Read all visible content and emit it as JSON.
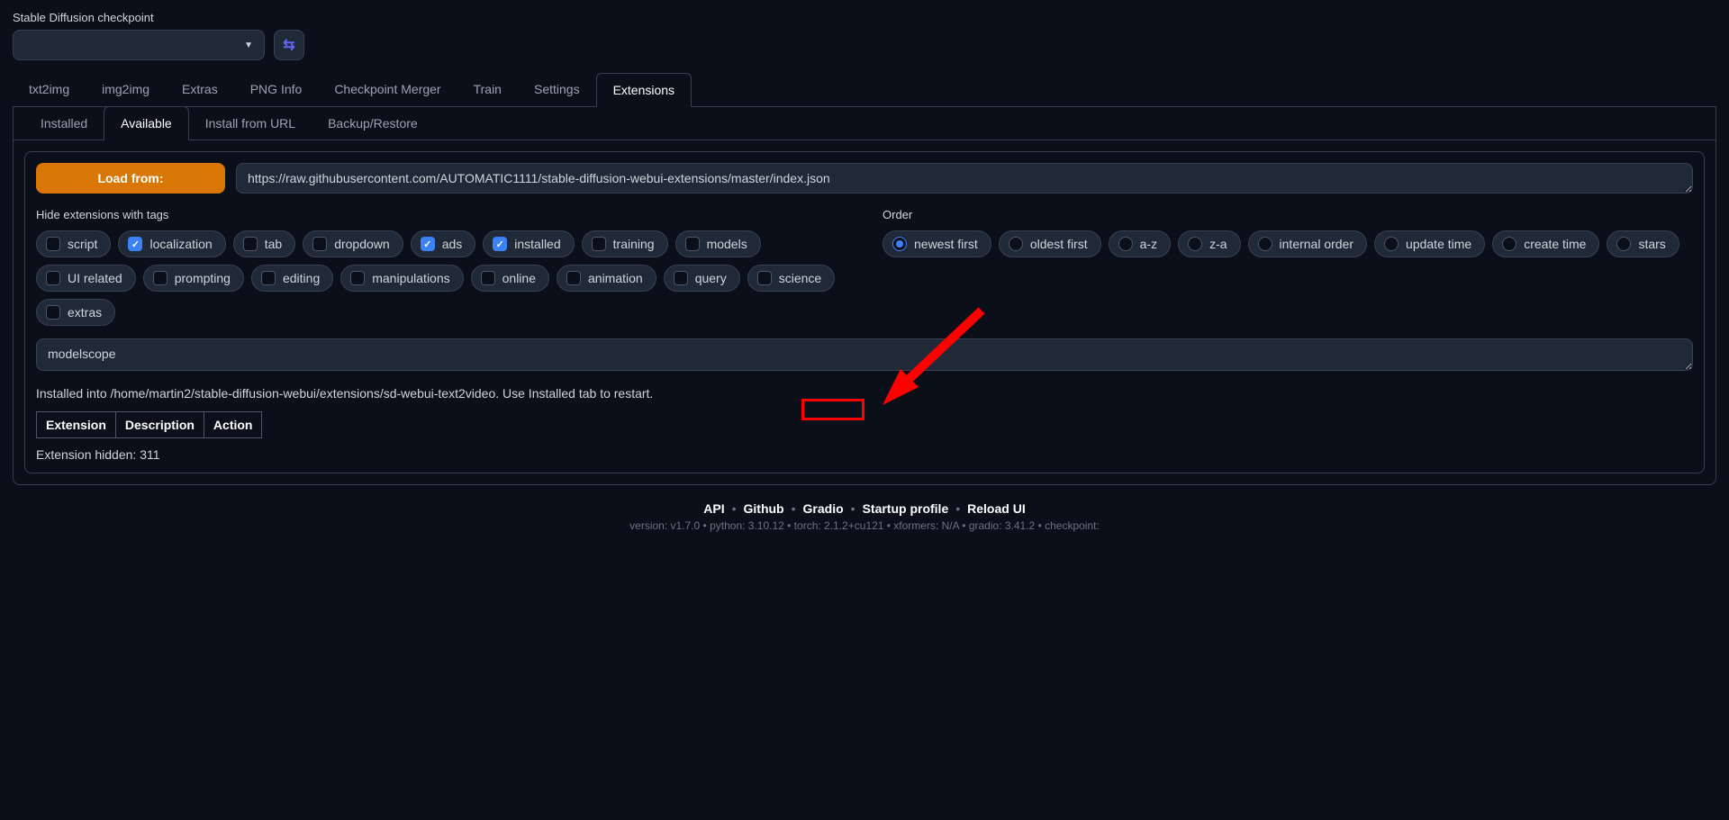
{
  "checkpoint": {
    "label": "Stable Diffusion checkpoint",
    "value": ""
  },
  "main_tabs": [
    "txt2img",
    "img2img",
    "Extras",
    "PNG Info",
    "Checkpoint Merger",
    "Train",
    "Settings",
    "Extensions"
  ],
  "main_active": 7,
  "sub_tabs": [
    "Installed",
    "Available",
    "Install from URL",
    "Backup/Restore"
  ],
  "sub_active": 1,
  "load_button": "Load from:",
  "index_url": "https://raw.githubusercontent.com/AUTOMATIC1111/stable-diffusion-webui-extensions/master/index.json",
  "hide_label": "Hide extensions with tags",
  "order_label": "Order",
  "tag_filters": [
    {
      "label": "script",
      "on": false
    },
    {
      "label": "localization",
      "on": true
    },
    {
      "label": "tab",
      "on": false
    },
    {
      "label": "dropdown",
      "on": false
    },
    {
      "label": "ads",
      "on": true
    },
    {
      "label": "installed",
      "on": true
    },
    {
      "label": "training",
      "on": false
    },
    {
      "label": "models",
      "on": false
    },
    {
      "label": "UI related",
      "on": false
    },
    {
      "label": "prompting",
      "on": false
    },
    {
      "label": "editing",
      "on": false
    },
    {
      "label": "manipulations",
      "on": false
    },
    {
      "label": "online",
      "on": false
    },
    {
      "label": "animation",
      "on": false
    },
    {
      "label": "query",
      "on": false
    },
    {
      "label": "science",
      "on": false
    },
    {
      "label": "extras",
      "on": false
    }
  ],
  "order_options": [
    {
      "label": "newest first",
      "on": true
    },
    {
      "label": "oldest first",
      "on": false
    },
    {
      "label": "a-z",
      "on": false
    },
    {
      "label": "z-a",
      "on": false
    },
    {
      "label": "internal order",
      "on": false
    },
    {
      "label": "update time",
      "on": false
    },
    {
      "label": "create time",
      "on": false
    },
    {
      "label": "stars",
      "on": false
    }
  ],
  "search_value": "modelscope",
  "install_status": "Installed into /home/martin2/stable-diffusion-webui/extensions/sd-webui-text2video. Use Installed tab to restart.",
  "table_headers": [
    "Extension",
    "Description",
    "Action"
  ],
  "hidden_text": "Extension hidden: 311",
  "footer_links": [
    "API",
    "Github",
    "Gradio",
    "Startup profile",
    "Reload UI"
  ],
  "footer_version": "version: v1.7.0  •  python: 3.10.12  •  torch: 2.1.2+cu121  •  xformers: N/A  •  gradio: 3.41.2  •  checkpoint:"
}
